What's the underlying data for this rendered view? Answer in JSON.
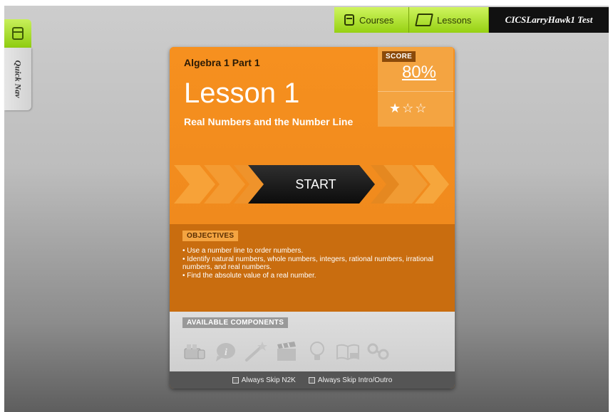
{
  "quick_nav": {
    "label": "Quick Nav"
  },
  "top_nav": {
    "courses_label": "Courses",
    "lessons_label": "Lessons",
    "user_name": "CICSLarryHawk1 Test"
  },
  "lesson": {
    "course_title": "Algebra 1 Part 1",
    "title": "Lesson 1",
    "subtitle": "Real Numbers and the Number Line",
    "score_label": "SCORE",
    "score_value": "80%",
    "stars_filled": 1,
    "stars_total": 3,
    "start_label": "START"
  },
  "objectives": {
    "label": "OBJECTIVES",
    "items": [
      "• Use a number line to order numbers.",
      "• Identify natural numbers, whole numbers, integers, rational numbers, irrational numbers, and real numbers.",
      "• Find the absolute value of a real number."
    ]
  },
  "components": {
    "label": "AVAILABLE COMPONENTS",
    "icons": [
      "blocks-icon",
      "info-bubble-icon",
      "magic-wand-icon",
      "clapperboard-icon",
      "lightbulb-icon",
      "pdf-book-icon",
      "link-chain-icon"
    ]
  },
  "footer": {
    "skip_n2k_label": "Always Skip N2K",
    "skip_intro_label": "Always Skip Intro/Outro"
  },
  "colors": {
    "accent_orange": "#f28c1e",
    "dark_orange": "#c96d0f",
    "nav_green": "#96d112"
  }
}
